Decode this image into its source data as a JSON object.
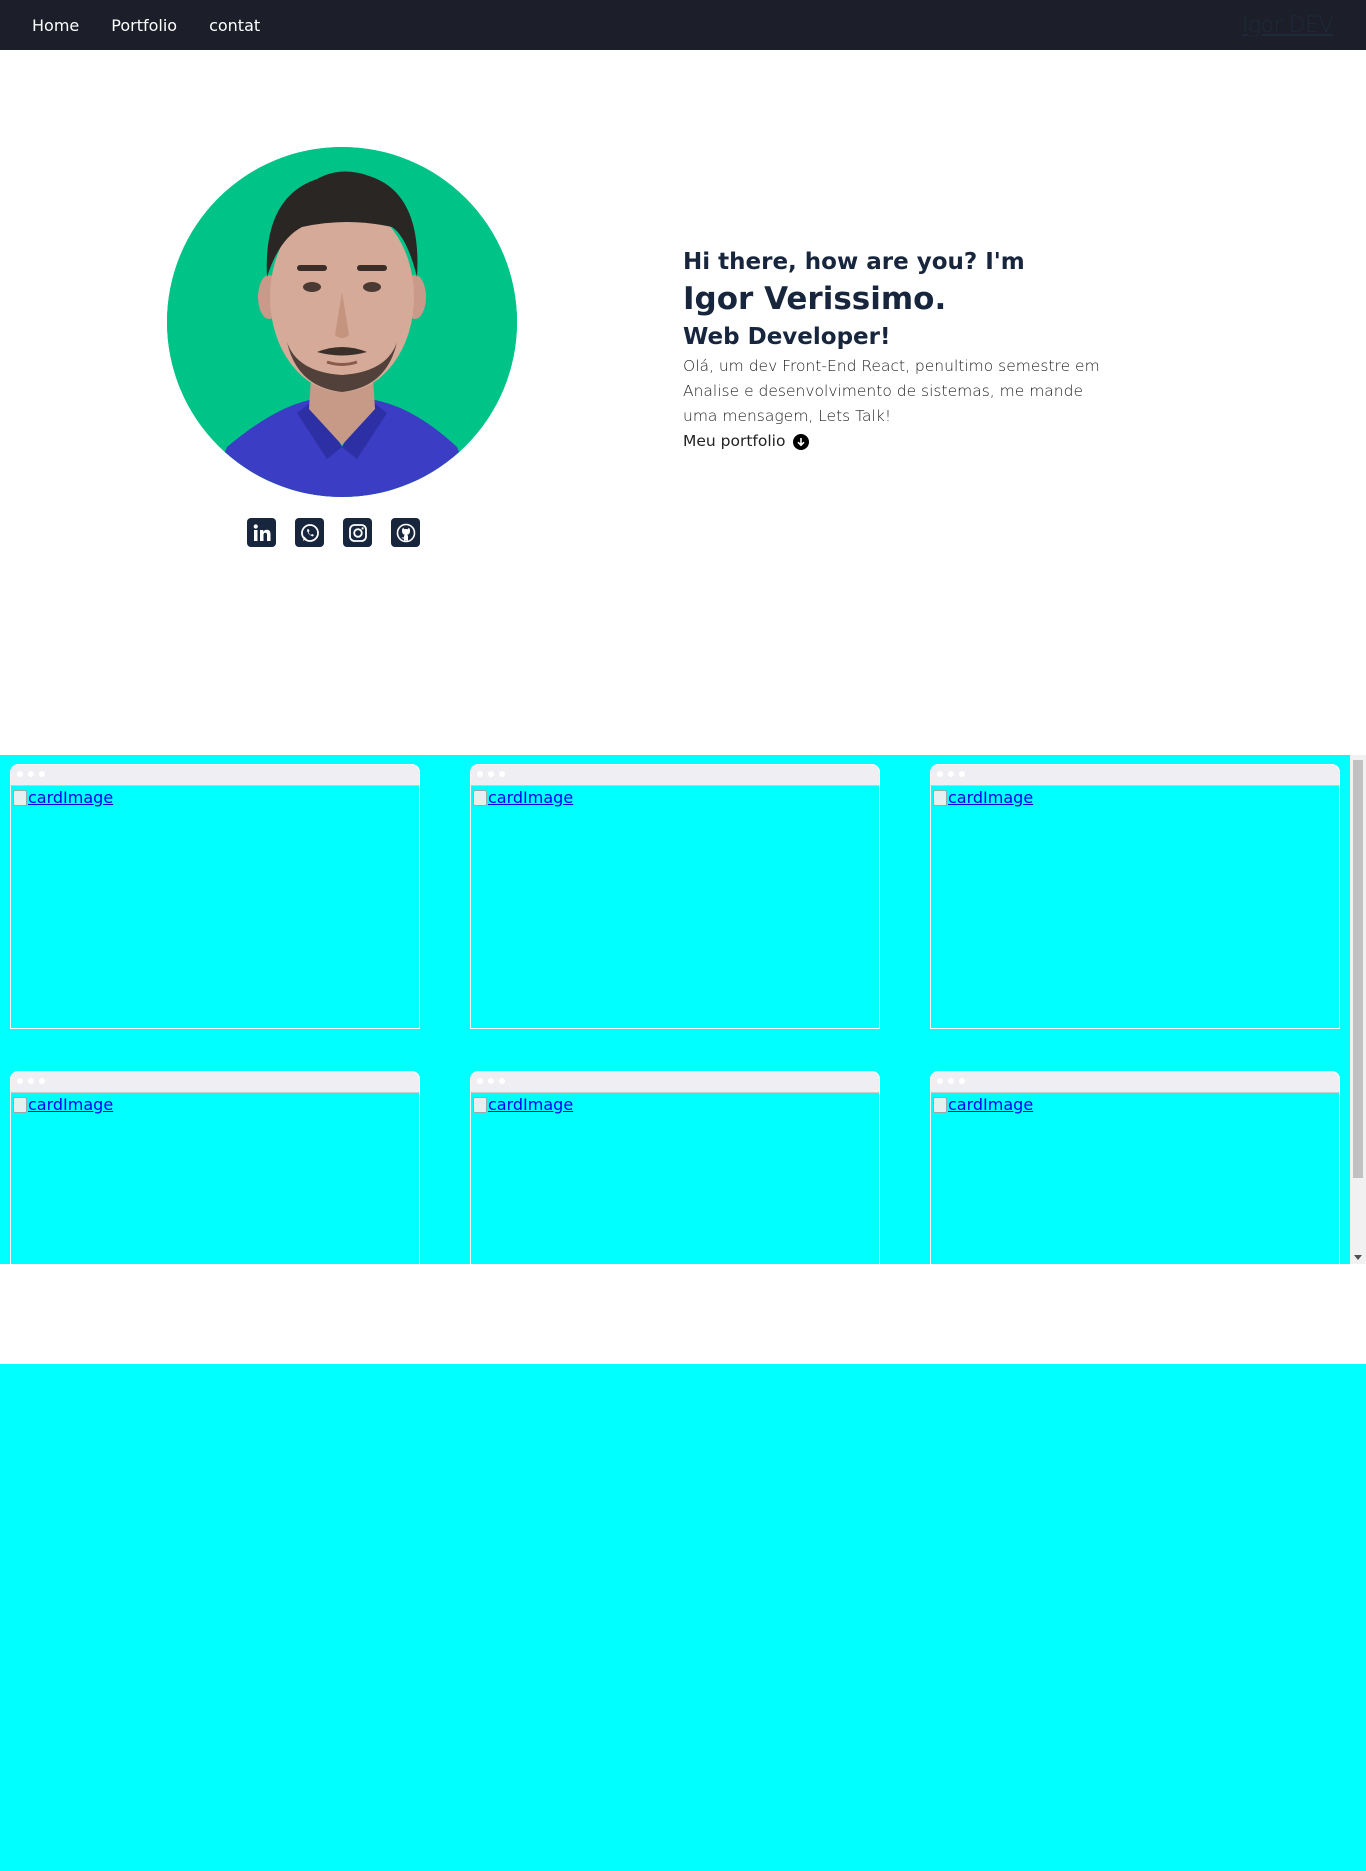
{
  "nav": {
    "links": [
      {
        "label": "Home"
      },
      {
        "label": "Portfolio"
      },
      {
        "label": "contat"
      }
    ],
    "brand": "Igor DEV"
  },
  "hero": {
    "greeting": "Hi there, how are you? I'm",
    "name": "Igor Verissimo.",
    "role": "Web Developer!",
    "description": "Olá, um dev Front-End React, penultimo semestre em Analise e desenvolvimento de sistemas, me mande uma mensagem, Lets Talk!",
    "portfolio_link": "Meu portfolio",
    "socials": [
      {
        "icon": "linkedin-icon"
      },
      {
        "icon": "whatsapp-icon"
      },
      {
        "icon": "instagram-icon"
      },
      {
        "icon": "github-icon"
      }
    ]
  },
  "portfolio": {
    "cards": [
      {
        "image_alt": "cardImage"
      },
      {
        "image_alt": "cardImage"
      },
      {
        "image_alt": "cardImage"
      },
      {
        "image_alt": "cardImage"
      },
      {
        "image_alt": "cardImage"
      },
      {
        "image_alt": "cardImage"
      }
    ]
  },
  "colors": {
    "navbar": "#1c1f29",
    "section_bg": "#00ffff",
    "text_dark": "#17263d",
    "avatar_bg": "#00c487"
  }
}
